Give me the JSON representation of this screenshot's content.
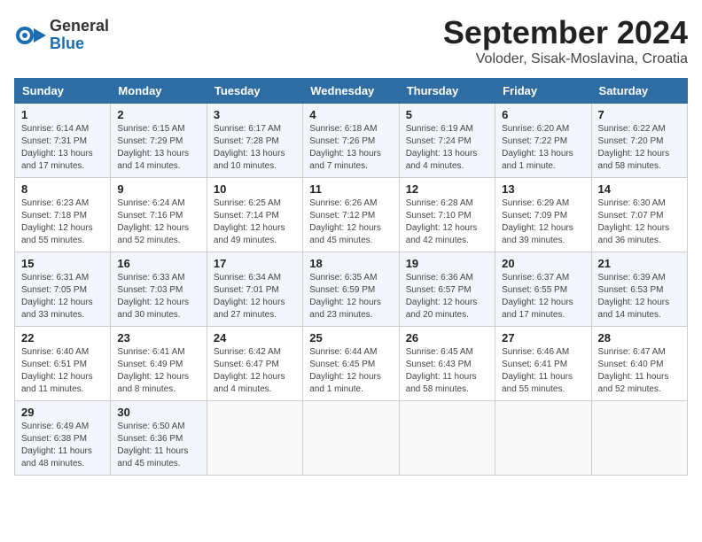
{
  "header": {
    "logo_general": "General",
    "logo_blue": "Blue",
    "month_title": "September 2024",
    "location": "Voloder, Sisak-Moslavina, Croatia"
  },
  "days_of_week": [
    "Sunday",
    "Monday",
    "Tuesday",
    "Wednesday",
    "Thursday",
    "Friday",
    "Saturday"
  ],
  "weeks": [
    [
      {
        "day": "1",
        "info": "Sunrise: 6:14 AM\nSunset: 7:31 PM\nDaylight: 13 hours and 17 minutes."
      },
      {
        "day": "2",
        "info": "Sunrise: 6:15 AM\nSunset: 7:29 PM\nDaylight: 13 hours and 14 minutes."
      },
      {
        "day": "3",
        "info": "Sunrise: 6:17 AM\nSunset: 7:28 PM\nDaylight: 13 hours and 10 minutes."
      },
      {
        "day": "4",
        "info": "Sunrise: 6:18 AM\nSunset: 7:26 PM\nDaylight: 13 hours and 7 minutes."
      },
      {
        "day": "5",
        "info": "Sunrise: 6:19 AM\nSunset: 7:24 PM\nDaylight: 13 hours and 4 minutes."
      },
      {
        "day": "6",
        "info": "Sunrise: 6:20 AM\nSunset: 7:22 PM\nDaylight: 13 hours and 1 minute."
      },
      {
        "day": "7",
        "info": "Sunrise: 6:22 AM\nSunset: 7:20 PM\nDaylight: 12 hours and 58 minutes."
      }
    ],
    [
      {
        "day": "8",
        "info": "Sunrise: 6:23 AM\nSunset: 7:18 PM\nDaylight: 12 hours and 55 minutes."
      },
      {
        "day": "9",
        "info": "Sunrise: 6:24 AM\nSunset: 7:16 PM\nDaylight: 12 hours and 52 minutes."
      },
      {
        "day": "10",
        "info": "Sunrise: 6:25 AM\nSunset: 7:14 PM\nDaylight: 12 hours and 49 minutes."
      },
      {
        "day": "11",
        "info": "Sunrise: 6:26 AM\nSunset: 7:12 PM\nDaylight: 12 hours and 45 minutes."
      },
      {
        "day": "12",
        "info": "Sunrise: 6:28 AM\nSunset: 7:10 PM\nDaylight: 12 hours and 42 minutes."
      },
      {
        "day": "13",
        "info": "Sunrise: 6:29 AM\nSunset: 7:09 PM\nDaylight: 12 hours and 39 minutes."
      },
      {
        "day": "14",
        "info": "Sunrise: 6:30 AM\nSunset: 7:07 PM\nDaylight: 12 hours and 36 minutes."
      }
    ],
    [
      {
        "day": "15",
        "info": "Sunrise: 6:31 AM\nSunset: 7:05 PM\nDaylight: 12 hours and 33 minutes."
      },
      {
        "day": "16",
        "info": "Sunrise: 6:33 AM\nSunset: 7:03 PM\nDaylight: 12 hours and 30 minutes."
      },
      {
        "day": "17",
        "info": "Sunrise: 6:34 AM\nSunset: 7:01 PM\nDaylight: 12 hours and 27 minutes."
      },
      {
        "day": "18",
        "info": "Sunrise: 6:35 AM\nSunset: 6:59 PM\nDaylight: 12 hours and 23 minutes."
      },
      {
        "day": "19",
        "info": "Sunrise: 6:36 AM\nSunset: 6:57 PM\nDaylight: 12 hours and 20 minutes."
      },
      {
        "day": "20",
        "info": "Sunrise: 6:37 AM\nSunset: 6:55 PM\nDaylight: 12 hours and 17 minutes."
      },
      {
        "day": "21",
        "info": "Sunrise: 6:39 AM\nSunset: 6:53 PM\nDaylight: 12 hours and 14 minutes."
      }
    ],
    [
      {
        "day": "22",
        "info": "Sunrise: 6:40 AM\nSunset: 6:51 PM\nDaylight: 12 hours and 11 minutes."
      },
      {
        "day": "23",
        "info": "Sunrise: 6:41 AM\nSunset: 6:49 PM\nDaylight: 12 hours and 8 minutes."
      },
      {
        "day": "24",
        "info": "Sunrise: 6:42 AM\nSunset: 6:47 PM\nDaylight: 12 hours and 4 minutes."
      },
      {
        "day": "25",
        "info": "Sunrise: 6:44 AM\nSunset: 6:45 PM\nDaylight: 12 hours and 1 minute."
      },
      {
        "day": "26",
        "info": "Sunrise: 6:45 AM\nSunset: 6:43 PM\nDaylight: 11 hours and 58 minutes."
      },
      {
        "day": "27",
        "info": "Sunrise: 6:46 AM\nSunset: 6:41 PM\nDaylight: 11 hours and 55 minutes."
      },
      {
        "day": "28",
        "info": "Sunrise: 6:47 AM\nSunset: 6:40 PM\nDaylight: 11 hours and 52 minutes."
      }
    ],
    [
      {
        "day": "29",
        "info": "Sunrise: 6:49 AM\nSunset: 6:38 PM\nDaylight: 11 hours and 48 minutes."
      },
      {
        "day": "30",
        "info": "Sunrise: 6:50 AM\nSunset: 6:36 PM\nDaylight: 11 hours and 45 minutes."
      },
      {
        "day": "",
        "info": ""
      },
      {
        "day": "",
        "info": ""
      },
      {
        "day": "",
        "info": ""
      },
      {
        "day": "",
        "info": ""
      },
      {
        "day": "",
        "info": ""
      }
    ]
  ]
}
